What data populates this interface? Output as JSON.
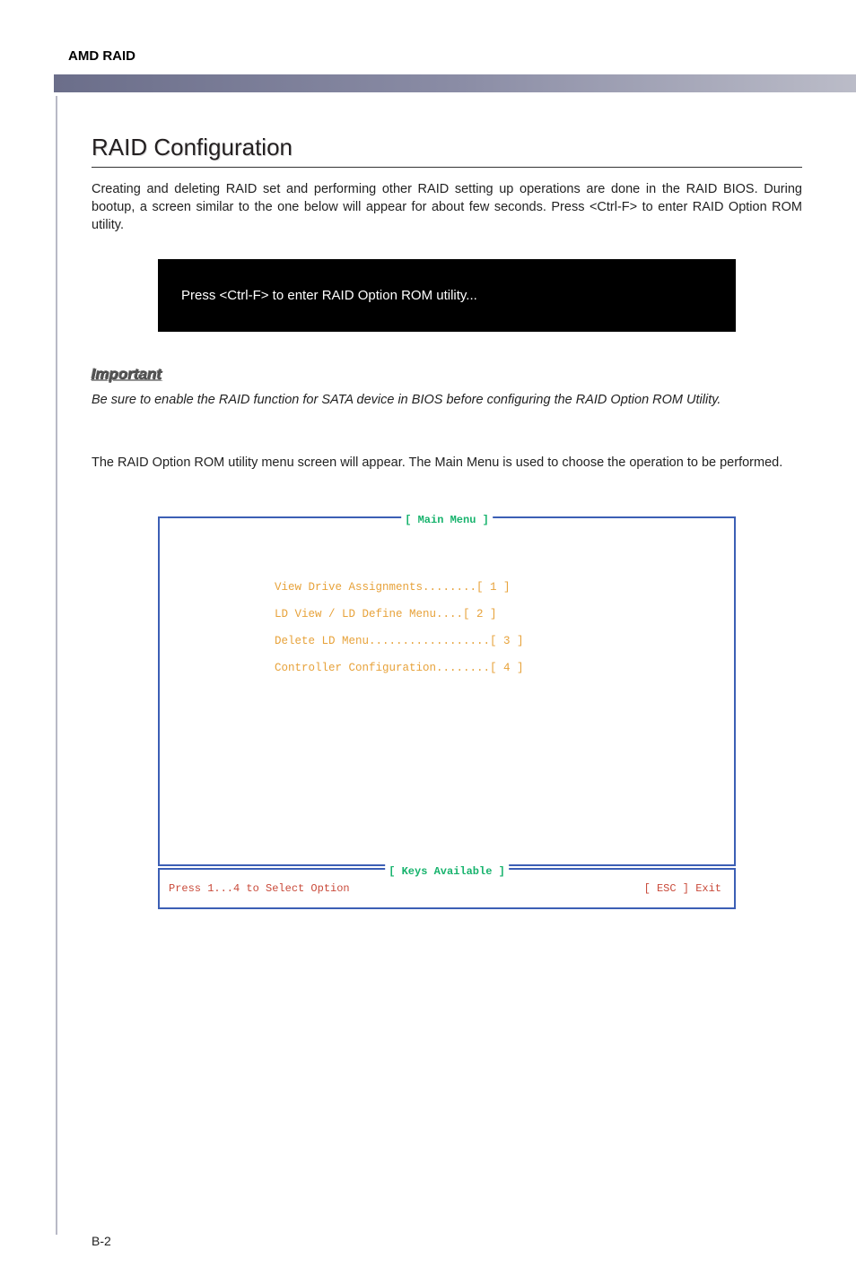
{
  "header": {
    "title": "AMD RAID"
  },
  "section": {
    "title": "RAID Configuration",
    "intro": "Creating and deleting RAID set and performing other RAID setting up operations are done in the RAID BIOS. During bootup, a screen similar to the one below will appear for about few seconds. Press <Ctrl-F> to enter RAID Option ROM utility.",
    "blackbox": "Press <Ctrl-F> to enter RAID Option ROM utility...",
    "important_label": "Important",
    "important_text": "Be sure to enable the RAID function for SATA device in BIOS before configuring the RAID Option ROM Utility.",
    "body2": "The RAID Option ROM utility menu screen will appear. The Main Menu is used to choose the operation to be performed."
  },
  "bios": {
    "main_title": "[ Main Menu ]",
    "items": [
      "View Drive Assignments........[  1  ]",
      "LD View / LD Define Menu....[  2  ]",
      "Delete LD Menu..................[  3  ]",
      "Controller Configuration........[  4  ]"
    ],
    "keys_title": "[ Keys Available ]",
    "keys_left": "Press 1...4 to Select Option",
    "keys_right": "[ ESC ]  Exit"
  },
  "footer": {
    "page": "B-2"
  }
}
